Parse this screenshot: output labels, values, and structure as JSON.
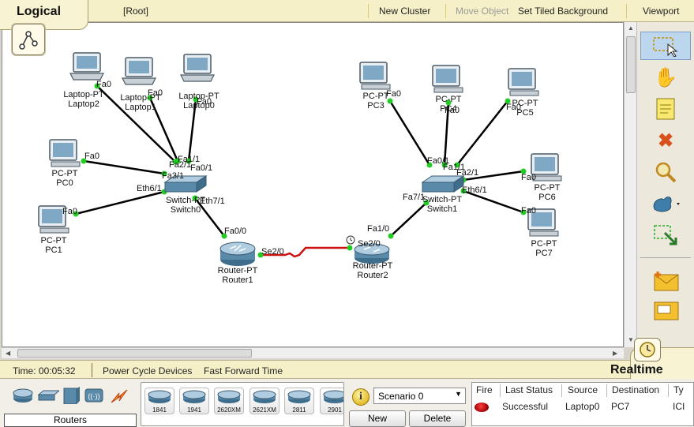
{
  "topbar": {
    "mode": "Logical",
    "root": "[Root]",
    "new_cluster": "New Cluster",
    "move_object": "Move Object",
    "set_tiled_background": "Set Tiled Background",
    "viewport": "Viewport"
  },
  "devices": {
    "laptop2": {
      "type": "Laptop-PT",
      "name": "Laptop2"
    },
    "laptop1": {
      "type": "Laptop-PT",
      "name": "Laptop1"
    },
    "laptop0": {
      "type": "Laptop-PT",
      "name": "Laptop0"
    },
    "pc0": {
      "type": "PC-PT",
      "name": "PC0"
    },
    "pc1": {
      "type": "PC-PT",
      "name": "PC1"
    },
    "switch0": {
      "type": "Switch-PT",
      "name": "Switch0"
    },
    "router1": {
      "type": "Router-PT",
      "name": "Router1"
    },
    "router2": {
      "type": "Router-PT",
      "name": "Router2"
    },
    "switch1": {
      "type": "Switch-PT",
      "name": "Switch1"
    },
    "pc3": {
      "type": "PC-PT",
      "name": "PC3"
    },
    "pc4": {
      "type": "PC-PT",
      "name": "PC4"
    },
    "pc5": {
      "type": "PC-PT",
      "name": "PC5"
    },
    "pc6": {
      "type": "PC-PT",
      "name": "PC6"
    },
    "pc7": {
      "type": "PC-PT",
      "name": "PC7"
    }
  },
  "ports": {
    "laptop2_fa0": "Fa0",
    "laptop1_fa0": "Fa0",
    "laptop0_fa0": "Fa0",
    "pc0_fa0": "Fa0",
    "pc1_fa0": "Fa0",
    "sw0_fa2": "Fa2/1",
    "sw0_fa1": "Fa1/1",
    "sw0_fa0": "Fa0/1",
    "sw0_fa3": "Fa3/1",
    "sw0_eth6": "Eth6/1",
    "sw0_eth7": "Eth7/1",
    "r1_fa0": "Fa0/0",
    "r1_se2": "Se2/0",
    "r2_se2": "Se2/0",
    "r2_fa1": "Fa1/0",
    "sw1_fa7": "Fa7/1",
    "sw1_fa0": "Fa0/1",
    "sw1_fa1": "Fa1/1",
    "sw1_fa2": "Fa2/1",
    "sw1_eth6": "Eth6/1",
    "pc3_fa0": "Fa0",
    "pc4_fa0": "Fa0",
    "pc5_fa0": "Fa0",
    "pc6_fa0": "Fa0",
    "pc7_fa0": "Fa0"
  },
  "status": {
    "time": "Time: 00:05:32",
    "power_cycle": "Power Cycle Devices",
    "fast_forward": "Fast Forward Time",
    "realtime": "Realtime"
  },
  "device_category": {
    "label": "Routers",
    "models": [
      "1841",
      "1941",
      "2620XM",
      "2621XM",
      "2811",
      "2901"
    ]
  },
  "scenario": {
    "selected": "Scenario 0",
    "new_label": "New",
    "delete_label": "Delete"
  },
  "pdu_table": {
    "headers": [
      "Fire",
      "Last Status",
      "Source",
      "Destination",
      "Ty"
    ],
    "rows": [
      {
        "last_status": "Successful",
        "source": "Laptop0",
        "destination": "PC7",
        "type": "ICI"
      }
    ]
  },
  "colors": {
    "link": "#000000",
    "serial_link": "#cc1111",
    "port_up": "#22cc22",
    "toolbar_bg": "#f6f0c8"
  }
}
